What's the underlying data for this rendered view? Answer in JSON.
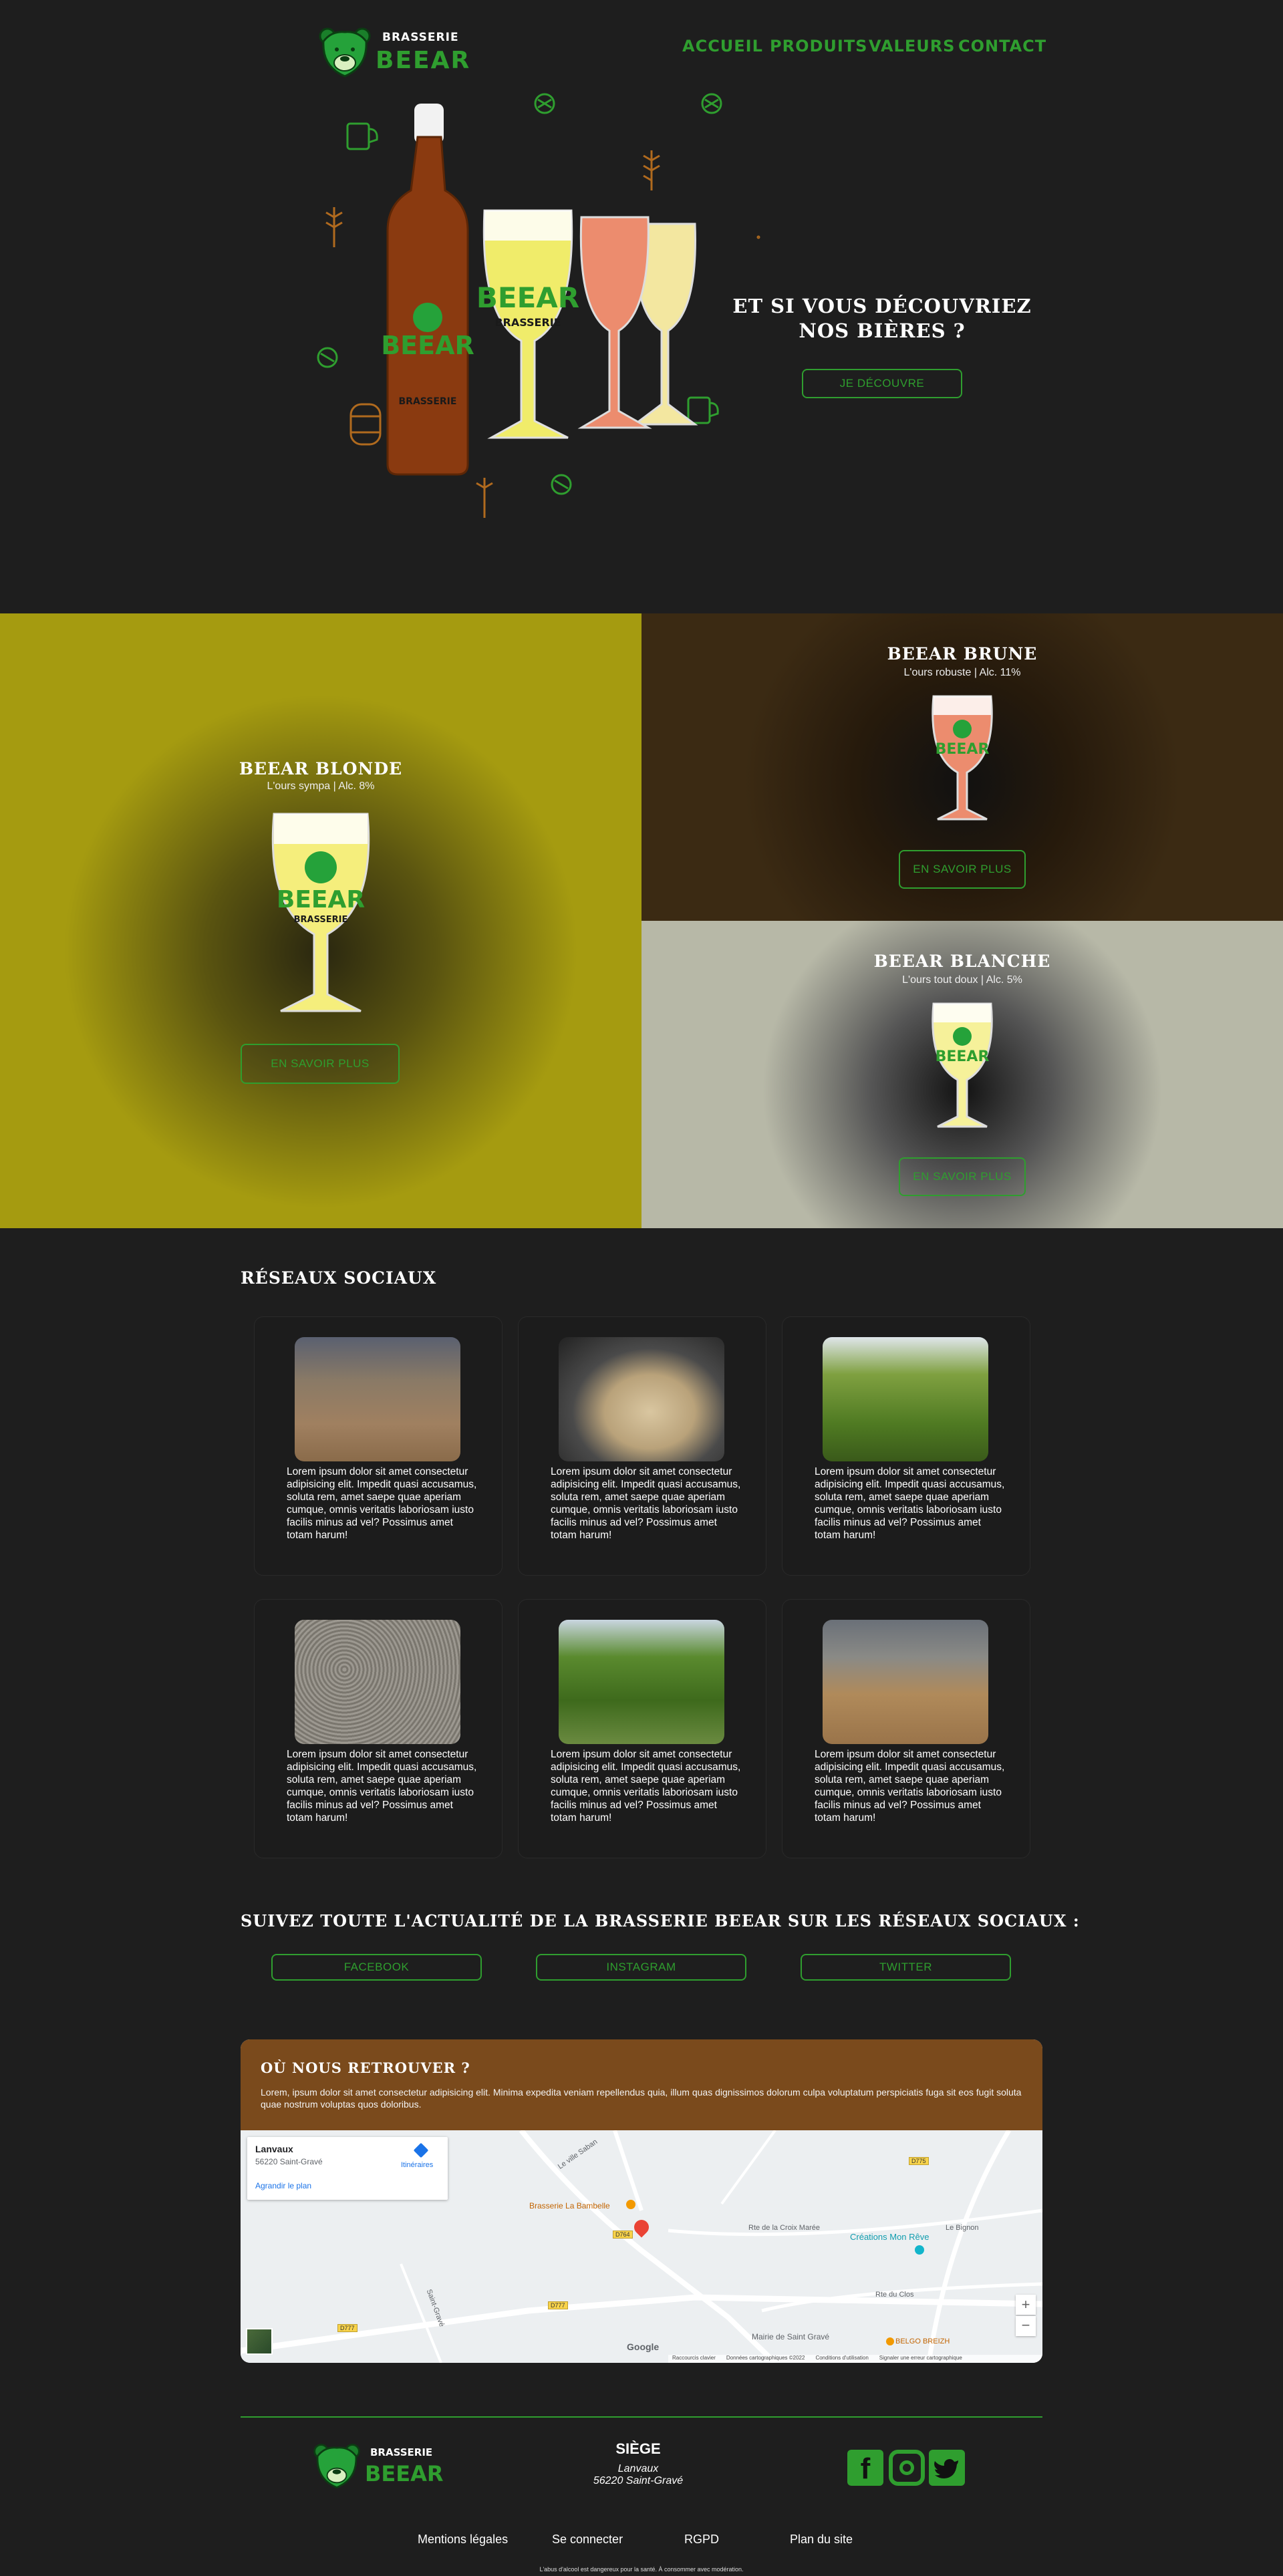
{
  "brand": {
    "top": "BRASSERIE",
    "bottom": "BEEAR"
  },
  "nav": [
    "ACCUEIL",
    "PRODUITS",
    "VALEURS",
    "CONTACT"
  ],
  "hero": {
    "title_line1": "ET SI VOUS DÉCOUVRIEZ",
    "title_line2": "NOS BIÈRES ?",
    "cta": "JE DÉCOUVRE",
    "bottle_label_top": "BEEAR",
    "bottle_label_bottom": "BRASSERIE"
  },
  "beers": [
    {
      "name": "BEEAR BLONDE",
      "desc": "L'ours sympa | Alc. 8%",
      "cta": "EN SAVOIR PLUS",
      "color": "#a59b10"
    },
    {
      "name": "BEEAR BRUNE",
      "desc": "L'ours robuste | Alc. 11%",
      "cta": "EN SAVOIR PLUS",
      "color": "#3b2a13"
    },
    {
      "name": "BEEAR BLANCHE",
      "desc": "L'ours tout doux | Alc. 5%",
      "cta": "EN SAVOIR PLUS",
      "color": "#b7b8a7"
    }
  ],
  "social": {
    "title": "RÉSEAUX SOCIAUX",
    "posts": [
      {
        "text": "Lorem ipsum dolor sit amet consectetur adipisicing elit. Impedit quasi accusamus, soluta rem, amet saepe quae aperiam cumque, omnis veritatis laboriosam iusto facilis minus ad vel? Possimus amet totam harum!",
        "image": "malt-floor"
      },
      {
        "text": "Lorem ipsum dolor sit amet consectetur adipisicing elit. Impedit quasi accusamus, soluta rem, amet saepe quae aperiam cumque, omnis veritatis laboriosam iusto facilis minus ad vel? Possimus amet totam harum!",
        "image": "brewing-tank"
      },
      {
        "text": "Lorem ipsum dolor sit amet consectetur adipisicing elit. Impedit quasi accusamus, soluta rem, amet saepe quae aperiam cumque, omnis veritatis laboriosam iusto facilis minus ad vel? Possimus amet totam harum!",
        "image": "hop-field"
      },
      {
        "text": "Lorem ipsum dolor sit amet consectetur adipisicing elit. Impedit quasi accusamus, soluta rem, amet saepe quae aperiam cumque, omnis veritatis laboriosam iusto facilis minus ad vel? Possimus amet totam harum!",
        "image": "grain"
      },
      {
        "text": "Lorem ipsum dolor sit amet consectetur adipisicing elit. Impedit quasi accusamus, soluta rem, amet saepe quae aperiam cumque, omnis veritatis laboriosam iusto facilis minus ad vel? Possimus amet totam harum!",
        "image": "hop-rows"
      },
      {
        "text": "Lorem ipsum dolor sit amet consectetur adipisicing elit. Impedit quasi accusamus, soluta rem, amet saepe quae aperiam cumque, omnis veritatis laboriosam iusto facilis minus ad vel? Possimus amet totam harum!",
        "image": "malt-warehouse"
      }
    ],
    "follow_title": "SUIVEZ TOUTE L'ACTUALITÉ DE LA BRASSERIE BEEAR SUR LES RÉSEAUX SOCIAUX :",
    "buttons": [
      "FACEBOOK",
      "INSTAGRAM",
      "TWITTER"
    ]
  },
  "location": {
    "title": "OÙ NOUS RETROUVER ?",
    "text": "Lorem, ipsum dolor sit amet consectetur adipisicing elit. Minima expedita veniam repellendus quia, illum quas dignissimos dolorum culpa voluptatum perspiciatis fuga sit eos fugit soluta quae nostrum voluptas quos doloribus.",
    "header_color": "#7a4a1c",
    "map": {
      "place": "Lanvaux",
      "address": "56220 Saint-Gravé",
      "enlarge": "Agrandir le plan",
      "directions": "Itinéraires",
      "poi1": "Brasserie La Bambelle",
      "poi2": "Créations Mon Rêve",
      "poi3": "Mairie de Saint Gravé",
      "poi4": "BELGO BREIZH",
      "road1": "Le ville Saban",
      "road2": "Rte de la Croix Marée",
      "road3": "Rte du Clos",
      "road4": "Saint-Gravé",
      "road5": "Le Bignon",
      "shield1": "D777",
      "shield2": "D764",
      "shield3": "D775",
      "footer": [
        "Raccourcis clavier",
        "Données cartographiques ©2022",
        "Conditions d'utilisation",
        "Signaler une erreur cartographique"
      ],
      "google": "Google"
    }
  },
  "footer": {
    "siege_title": "SIÈGE",
    "siege_line1": "Lanvaux",
    "siege_line2": "56220 Saint-Gravé",
    "links": [
      "Mentions légales",
      "Se connecter",
      "RGPD",
      "Plan du site"
    ],
    "legal": "L'abus d'alcool est dangereux pour la santé. À consommer avec modération."
  },
  "colors": {
    "accent": "#2f9e2f",
    "background": "#1e1e1e",
    "hop_orange": "#b06a1e"
  }
}
